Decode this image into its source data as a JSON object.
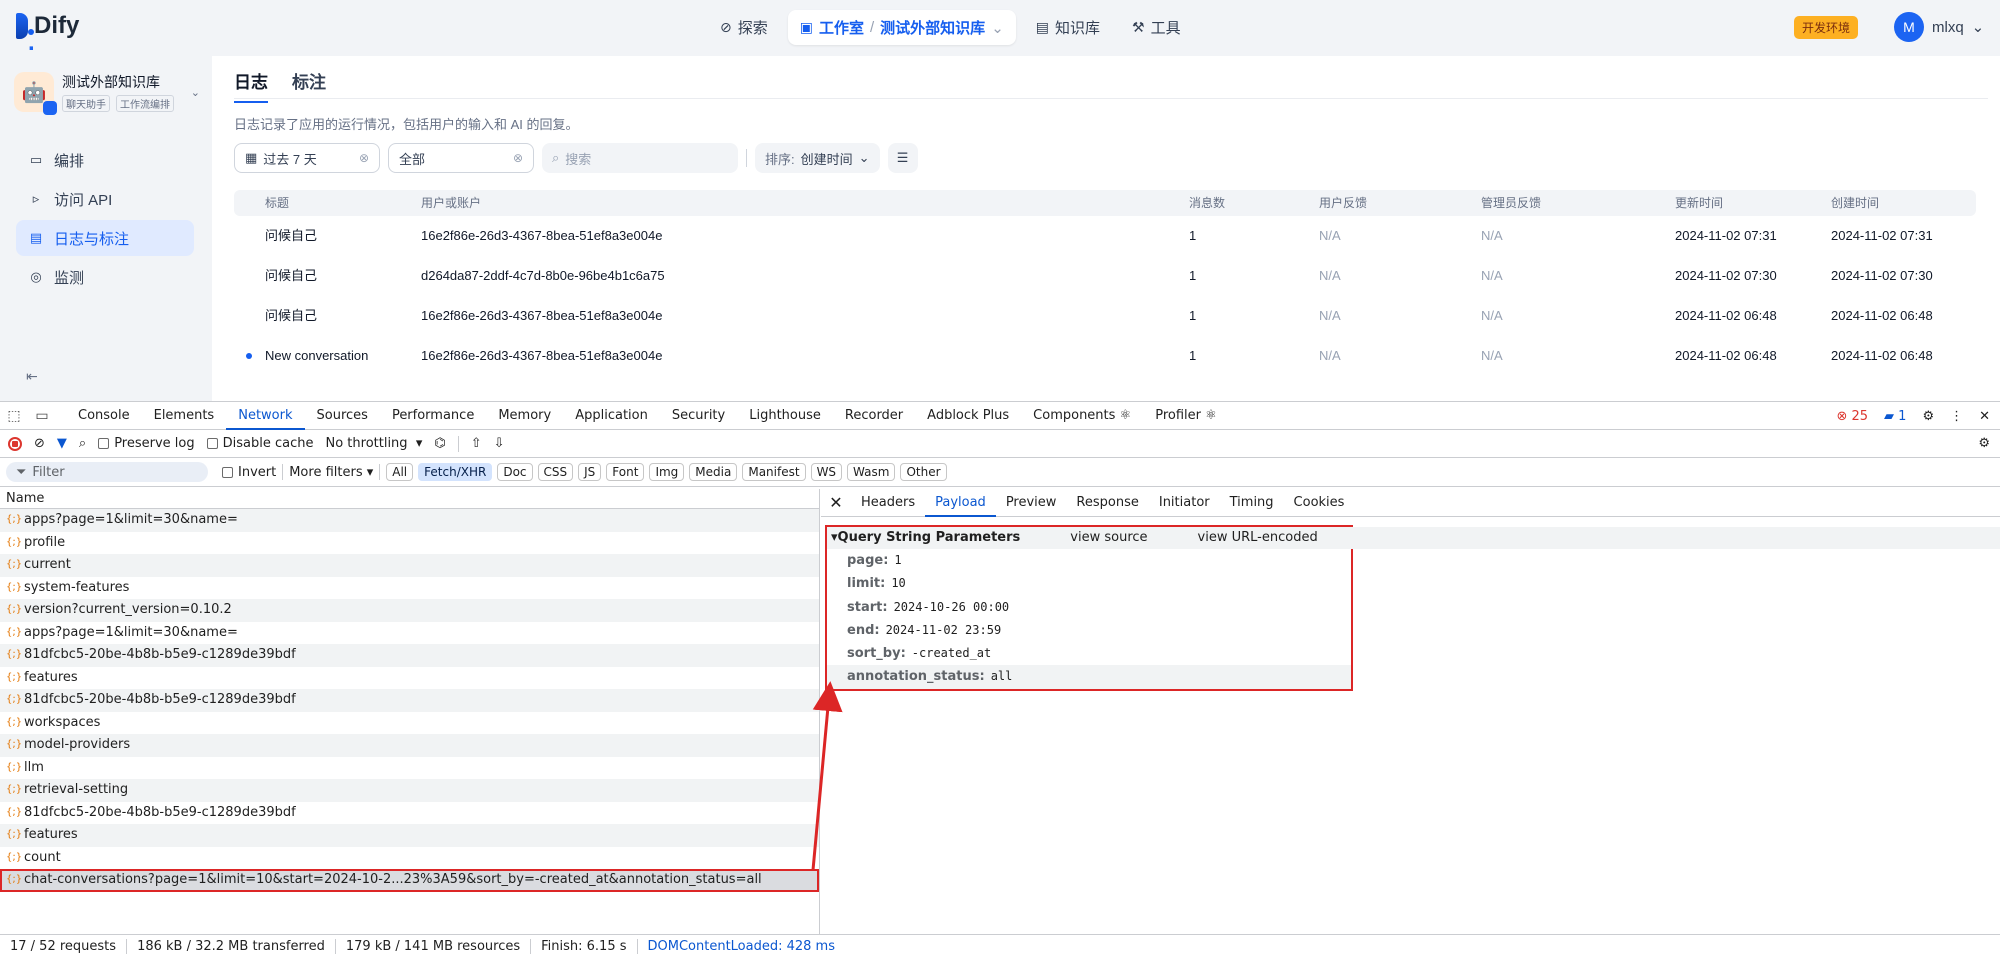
{
  "app": {
    "logo_text": "Dify",
    "logo_dot": "."
  },
  "nav": {
    "explore": "探索",
    "studio": "工作室",
    "sep": "/",
    "current_app": "测试外部知识库",
    "knowledge": "知识库",
    "tools": "工具"
  },
  "env_tag": "开发环境",
  "user": {
    "initial": "M",
    "name": "mlxq"
  },
  "sidebar": {
    "app_name": "测试外部知识库",
    "tags": [
      "聊天助手",
      "工作流编排"
    ],
    "items": [
      {
        "label": "编排",
        "icon": "layout-icon"
      },
      {
        "label": "访问 API",
        "icon": "terminal-icon"
      },
      {
        "label": "日志与标注",
        "icon": "file-text-icon"
      },
      {
        "label": "监测",
        "icon": "monitor-icon"
      }
    ]
  },
  "main": {
    "tabs": [
      "日志",
      "标注"
    ],
    "description": "日志记录了应用的运行情况，包括用户的输入和 AI 的回复。",
    "filter_period": "过去 7 天",
    "filter_status": "全部",
    "search_placeholder": "搜索",
    "sort_label": "排序:",
    "sort_value": "创建时间",
    "columns": [
      "标题",
      "用户或账户",
      "消息数",
      "用户反馈",
      "管理员反馈",
      "更新时间",
      "创建时间"
    ],
    "rows": [
      {
        "title": "问候自己",
        "user": "16e2f86e-26d3-4367-8bea-51ef8a3e004e",
        "messages": "1",
        "user_fb": "N/A",
        "admin_fb": "N/A",
        "updated": "2024-11-02 07:31",
        "created": "2024-11-02 07:31",
        "unread": false
      },
      {
        "title": "问候自己",
        "user": "d264da87-2ddf-4c7d-8b0e-96be4b1c6a75",
        "messages": "1",
        "user_fb": "N/A",
        "admin_fb": "N/A",
        "updated": "2024-11-02 07:30",
        "created": "2024-11-02 07:30",
        "unread": false
      },
      {
        "title": "问候自己",
        "user": "16e2f86e-26d3-4367-8bea-51ef8a3e004e",
        "messages": "1",
        "user_fb": "N/A",
        "admin_fb": "N/A",
        "updated": "2024-11-02 06:48",
        "created": "2024-11-02 06:48",
        "unread": false
      },
      {
        "title": "New conversation",
        "user": "16e2f86e-26d3-4367-8bea-51ef8a3e004e",
        "messages": "1",
        "user_fb": "N/A",
        "admin_fb": "N/A",
        "updated": "2024-11-02 06:48",
        "created": "2024-11-02 06:48",
        "unread": true
      }
    ]
  },
  "devtools": {
    "tabs": [
      "Console",
      "Elements",
      "Network",
      "Sources",
      "Performance",
      "Memory",
      "Application",
      "Security",
      "Lighthouse",
      "Recorder",
      "Adblock Plus",
      "Components ⚛",
      "Profiler ⚛"
    ],
    "active_tab": "Network",
    "errors": "25",
    "messages": "1",
    "preserve_log": "Preserve log",
    "disable_cache": "Disable cache",
    "throttling": "No throttling",
    "filter_placeholder": "Filter",
    "invert": "Invert",
    "more_filters": "More filters",
    "type_chips": [
      "All",
      "Fetch/XHR",
      "Doc",
      "CSS",
      "JS",
      "Font",
      "Img",
      "Media",
      "Manifest",
      "WS",
      "Wasm",
      "Other"
    ],
    "active_chip": "Fetch/XHR",
    "name_header": "Name",
    "requests": [
      "apps?page=1&limit=30&name=",
      "profile",
      "current",
      "system-features",
      "version?current_version=0.10.2",
      "apps?page=1&limit=30&name=",
      "81dfcbc5-20be-4b8b-b5e9-c1289de39bdf",
      "features",
      "81dfcbc5-20be-4b8b-b5e9-c1289de39bdf",
      "workspaces",
      "model-providers",
      "llm",
      "retrieval-setting",
      "81dfcbc5-20be-4b8b-b5e9-c1289de39bdf",
      "features",
      "count",
      "chat-conversations?page=1&limit=10&start=2024-10-2...23%3A59&sort_by=-created_at&annotation_status=all"
    ],
    "selected_request_index": 16,
    "detail_tabs": [
      "Headers",
      "Payload",
      "Preview",
      "Response",
      "Initiator",
      "Timing",
      "Cookies"
    ],
    "active_detail_tab": "Payload",
    "qsp_title": "Query String Parameters",
    "view_source": "view source",
    "view_url_encoded": "view URL-encoded",
    "params": [
      {
        "key": "page:",
        "value": "1"
      },
      {
        "key": "limit:",
        "value": "10"
      },
      {
        "key": "start:",
        "value": "2024-10-26 00:00"
      },
      {
        "key": "end:",
        "value": "2024-11-02 23:59"
      },
      {
        "key": "sort_by:",
        "value": "-created_at"
      },
      {
        "key": "annotation_status:",
        "value": "all"
      }
    ],
    "status_bar": [
      "17 / 52 requests",
      "186 kB / 32.2 MB transferred",
      "179 kB / 141 MB resources",
      "Finish: 6.15 s",
      "DOMContentLoaded: 428 ms"
    ]
  },
  "colors": {
    "accent": "#155eef",
    "highlight": "#dc2626",
    "devtools_blue": "#0b57d0"
  }
}
